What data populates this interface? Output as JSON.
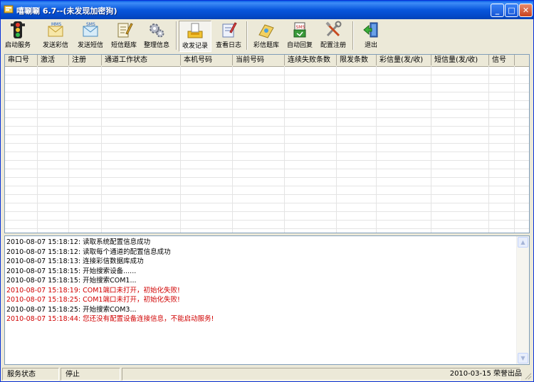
{
  "window": {
    "title": "嘻唰唰 6.7--(未发现加密狗)",
    "buttons": {
      "minimize": "_",
      "maximize": "□",
      "close": "✕"
    }
  },
  "toolbar": {
    "items": [
      {
        "label": "启动服务",
        "icon": "traffic-light-icon"
      },
      {
        "label": "发送彩信",
        "icon": "mms-send-icon"
      },
      {
        "label": "发送短信",
        "icon": "sms-send-icon"
      },
      {
        "label": "短信题库",
        "icon": "notepad-pencil-icon"
      },
      {
        "label": "整理信息",
        "icon": "gears-icon"
      },
      {
        "label": "收发记录",
        "icon": "inbox-tray-icon"
      },
      {
        "label": "查看日志",
        "icon": "log-pencil-icon"
      },
      {
        "label": "彩信题库",
        "icon": "mms-library-icon"
      },
      {
        "label": "自动回复",
        "icon": "auto-reply-icon"
      },
      {
        "label": "配置注册",
        "icon": "tools-icon"
      },
      {
        "label": "退出",
        "icon": "exit-door-icon"
      }
    ]
  },
  "grid": {
    "columns": [
      "串口号",
      "激活",
      "注册",
      "通道工作状态",
      "本机号码",
      "当前号码",
      "连续失败条数",
      "限发条数",
      "彩信量(发/收)",
      "短信量(发/收)",
      "信号"
    ]
  },
  "log": {
    "lines": [
      {
        "text": "2010-08-07 15:18:12: 读取系统配置信息成功",
        "error": false
      },
      {
        "text": "2010-08-07 15:18:12: 读取每个通道的配置信息成功",
        "error": false
      },
      {
        "text": "2010-08-07 15:18:13: 连接彩信数据库成功",
        "error": false
      },
      {
        "text": "2010-08-07 15:18:15: 开始搜索设备......",
        "error": false
      },
      {
        "text": "2010-08-07 15:18:15: 开始搜索COM1...",
        "error": false
      },
      {
        "text": "2010-08-07 15:18:19: COM1端口未打开，初始化失败!",
        "error": true
      },
      {
        "text": "2010-08-07 15:18:25: COM1端口未打开，初始化失败!",
        "error": true
      },
      {
        "text": "2010-08-07 15:18:25: 开始搜索COM3...",
        "error": false
      },
      {
        "text": "2010-08-07 15:18:44: 您还没有配置设备连接信息，不能启动服务!",
        "error": true
      }
    ]
  },
  "status": {
    "label": "服务状态",
    "value": "停止",
    "footer": "2010-03-15 荣誉出品"
  },
  "colors": {
    "error_text": "#D00000",
    "titlebar": "#0856DC"
  }
}
